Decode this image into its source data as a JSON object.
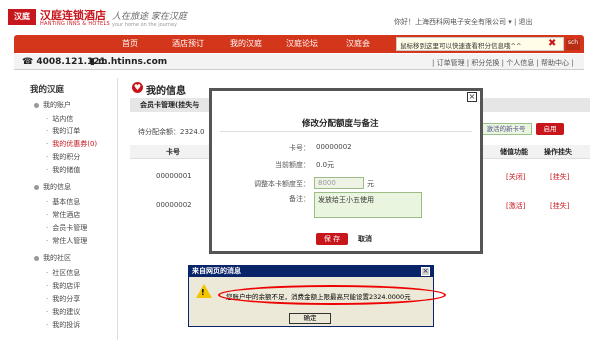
{
  "header": {
    "logo_text": "汉庭",
    "brand": "汉庭连锁酒店",
    "brand_en": "HANTING INNS & HOTELS",
    "slogan": "人在旅途 家在汉庭",
    "slogan_en": "your home on the journey",
    "user_text": "你好！上海西科网电子安全有限公司 ▾ | 退出"
  },
  "nav": {
    "items": [
      "首页",
      "酒店预订",
      "我的汉庭",
      "汉庭论坛",
      "汉庭会"
    ],
    "tooltip": "鼠标移到这里可以快速查看积分信息哦^^",
    "right_label": "sch"
  },
  "subbar": {
    "phone": "4008.121.121",
    "mobile": "m.htinns.com",
    "links": "| 订单管理 | 积分兑换 | 个人信息 | 帮助中心 |"
  },
  "sidebar": {
    "title": "我的汉庭",
    "sections": [
      {
        "label": "我的账户",
        "items": [
          "站内信",
          "我的订单",
          "我的优惠券(0)",
          "我的积分",
          "我的储值"
        ]
      },
      {
        "label": "我的信息",
        "items": [
          "基本信息",
          "常住酒店",
          "会员卡管理",
          "常住人管理"
        ]
      },
      {
        "label": "我的社区",
        "items": [
          "社区信息",
          "我的店评",
          "我的分享",
          "我的建议",
          "我的投诉"
        ]
      }
    ]
  },
  "main": {
    "title": "我的信息",
    "tab": "会员卡管理(挂失与",
    "pending": "待分配余额：2324.0",
    "btn_new_card": "激活的新卡号",
    "btn_apply": "启用",
    "columns": [
      "卡号",
      "储值功能",
      "操作挂失"
    ],
    "rows": [
      {
        "card": "00000001",
        "func": "[关闭]",
        "op": "[挂失]"
      },
      {
        "card": "00000002",
        "func": "[激活]",
        "op": "[挂失]"
      }
    ]
  },
  "modal": {
    "title": "修改分配额度与备注",
    "close": "×",
    "card_label": "卡号：",
    "card_value": "00000002",
    "current_label": "当前额度：",
    "current_value": "0.0元",
    "adjust_label": "调整本卡额度至：",
    "adjust_value": "8000",
    "unit": "元",
    "remark_label": "备注：",
    "remark_value": "发放给王小五使用",
    "save": "保 存",
    "cancel": "取消"
  },
  "alert": {
    "title": "来自网页的消息",
    "close": "×",
    "message": "您账户中的余额不足，消费金额上限最高只能设置2324.0000元",
    "ok": "确定"
  }
}
